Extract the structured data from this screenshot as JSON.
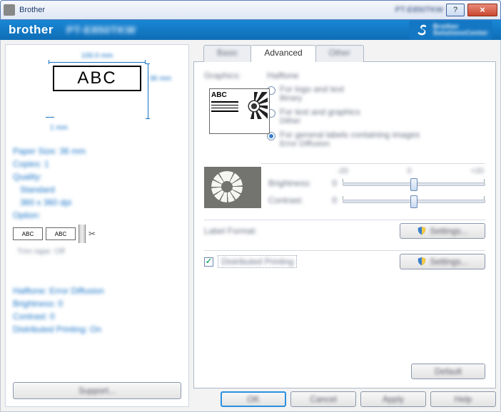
{
  "titlebar": {
    "app": "Brother",
    "model": "PT-E850TKW",
    "help": "?",
    "close": "×"
  },
  "brandbar": {
    "brand": "brother",
    "model": "PT-E850TKW",
    "sol1": "Brother",
    "sol2": "SolutionsCenter"
  },
  "left": {
    "dim_top": "100.0 mm",
    "dim_right": "36 mm",
    "dim_bottom": "1 mm",
    "preview_text": "ABC",
    "info": {
      "paper": "Paper Size: 36 mm",
      "copies": "Copies: 1",
      "quality": "Quality:",
      "quality_1": "Standard",
      "quality_2": "360 x 360 dpi",
      "option": "Option:",
      "trim": "Trim tape: Off"
    },
    "mini1": "ABC",
    "mini2": "ABC",
    "info2": {
      "halftone": "Halftone: Error Diffusion",
      "brightness": "Brightness:  0",
      "contrast": "Contrast:  0",
      "dist": "Distributed Printing: On"
    },
    "support": "Support..."
  },
  "tabs": {
    "basic": "Basic",
    "advanced": "Advanced",
    "other": "Other"
  },
  "advanced": {
    "graphics": "Graphics:",
    "thumb_text": "ABC",
    "halftone_heading": "Halftone",
    "r1": "For logo and text",
    "r1sub": "Binary",
    "r2": "For text and graphics",
    "r2sub": "Dither",
    "r3": "For general labels containing images",
    "r3sub": "Error Diffusion",
    "scale_min": "-20",
    "scale_mid": "0",
    "scale_max": "+20",
    "brightness": "Brightness:",
    "brightness_val": "0",
    "contrast": "Contrast:",
    "contrast_val": "0",
    "label_format": "Label Format:",
    "settings1": "Settings...",
    "dist_chk": "Distributed Printing",
    "settings2": "Settings...",
    "default": "Default"
  },
  "dialog": {
    "ok": "OK",
    "cancel": "Cancel",
    "apply": "Apply",
    "help": "Help"
  }
}
